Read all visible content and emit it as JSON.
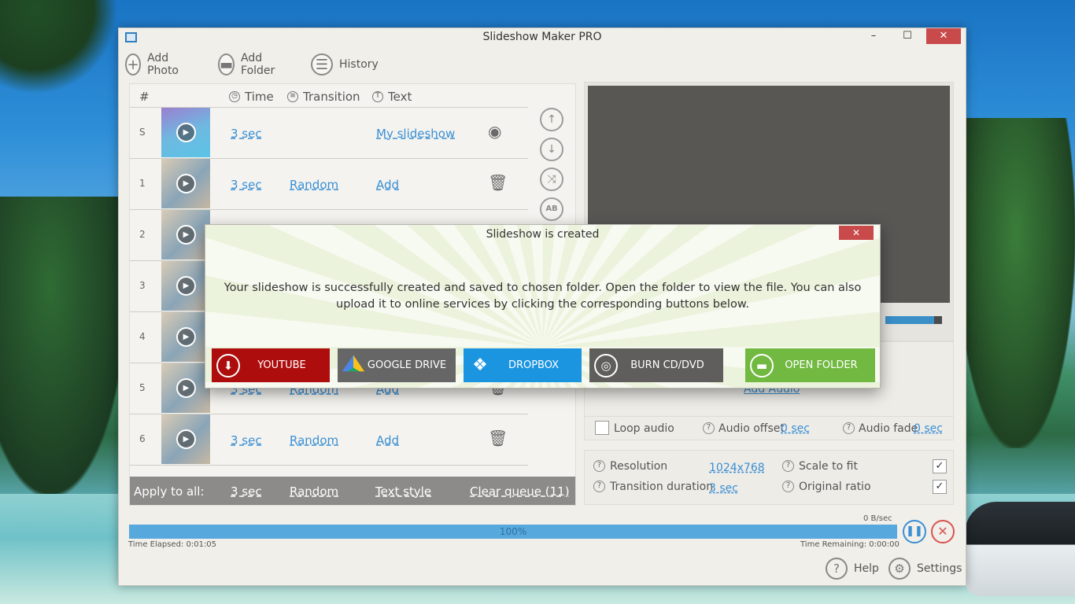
{
  "app": {
    "title": "Slideshow Maker PRO",
    "window_controls": {
      "minimize": "–",
      "maximize": "☐",
      "close": "✕"
    }
  },
  "toolbar": {
    "add_photo": "Add Photo",
    "add_folder": "Add Folder",
    "history": "History"
  },
  "list": {
    "headers": {
      "num": "#",
      "time": "Time",
      "transition": "Transition",
      "text": "Text"
    },
    "rows": [
      {
        "num": "S",
        "time": "3 sec",
        "transition": "",
        "text": "My slideshow",
        "action_icon": "eye-icon"
      },
      {
        "num": "1",
        "time": "3 sec",
        "transition": "Random",
        "text": "Add",
        "action_icon": "trash-icon"
      },
      {
        "num": "2",
        "time": "",
        "transition": "",
        "text": "",
        "action_icon": ""
      },
      {
        "num": "3",
        "time": "",
        "transition": "",
        "text": "",
        "action_icon": ""
      },
      {
        "num": "4",
        "time": "",
        "transition": "",
        "text": "",
        "action_icon": ""
      },
      {
        "num": "5",
        "time": "3 sec",
        "transition": "Random",
        "text": "Add",
        "action_icon": "trash-icon"
      },
      {
        "num": "6",
        "time": "3 sec",
        "transition": "Random",
        "text": "Add",
        "action_icon": "trash-icon"
      }
    ],
    "apply_bar": {
      "label": "Apply to all:",
      "time": "3 sec",
      "transition": "Random",
      "text_style": "Text style",
      "clear_queue": "Clear queue (11)"
    }
  },
  "audio": {
    "add_audio": "Add Audio",
    "loop_audio": "Loop audio",
    "audio_offset_label": "Audio offset",
    "audio_offset_value": "0 sec",
    "audio_fade_label": "Audio fade",
    "audio_fade_value": "0 sec"
  },
  "output": {
    "resolution_label": "Resolution",
    "resolution_value": "1024x768",
    "transition_duration_label": "Transition duration",
    "transition_duration_value": "3 sec",
    "scale_to_fit": "Scale to fit",
    "original_ratio": "Original ratio",
    "check_mark": "✓"
  },
  "progress": {
    "speed": "0 B/sec",
    "percent_text": "100%",
    "elapsed": "Time Elapsed: 0:01:05",
    "remaining": "Time Remaining: 0:00:00"
  },
  "footer": {
    "help": "Help",
    "settings": "Settings"
  },
  "dialog": {
    "title": "Slideshow is created",
    "close": "✕",
    "message": "Your slideshow is successfully created and saved to chosen folder. Open the folder to view the file. You can also upload it to online services by clicking the corresponding buttons below.",
    "buttons": {
      "youtube": "YOUTUBE",
      "google_drive": "GOOGLE DRIVE",
      "dropbox": "DROPBOX",
      "burn": "BURN CD/DVD",
      "open_folder": "OPEN FOLDER"
    }
  },
  "colors": {
    "accent": "#3a8fd4",
    "youtube": "#ad0d0d",
    "dropbox": "#1b95e0",
    "open_folder": "#71b941",
    "close_red": "#c94a4a"
  }
}
